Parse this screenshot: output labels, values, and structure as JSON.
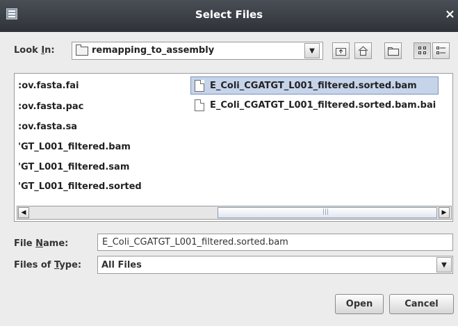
{
  "window": {
    "title": "Select Files",
    "close_glyph": "×"
  },
  "look_in": {
    "label_prefix": "Look ",
    "label_mnemonic": "I",
    "label_suffix": "n:",
    "value": "remapping_to_assembly",
    "dropdown_arrow": "▼"
  },
  "toolbar": {
    "icons": [
      "up-one-level-icon",
      "home-icon",
      "new-folder-icon",
      "list-view-icon",
      "details-view-icon"
    ]
  },
  "file_list": {
    "column1": [
      {
        "name": "cov.fasta.fai",
        "display": ":ov.fasta.fai"
      },
      {
        "name": "cov.fasta.pac",
        "display": ":ov.fasta.pac"
      },
      {
        "name": "cov.fasta.sa",
        "display": ":ov.fasta.sa"
      },
      {
        "name": "GT_L001_filtered.bam",
        "display": "'GT_L001_filtered.bam"
      },
      {
        "name": "GT_L001_filtered.sam",
        "display": "'GT_L001_filtered.sam"
      },
      {
        "name": "GT_L001_filtered.sorted",
        "display": "'GT_L001_filtered.sorted"
      }
    ],
    "column2": [
      {
        "name": "E_Coli_CGATGT_L001_filtered.sorted.bam",
        "selected": true
      },
      {
        "name": "E_Coli_CGATGT_L001_filtered.sorted.bam.bai",
        "selected": false
      }
    ],
    "scroll_left": "◀",
    "scroll_right": "▶",
    "scroll_grip": "|||"
  },
  "file_name": {
    "label_prefix": "File ",
    "label_mnemonic": "N",
    "label_suffix": "ame:",
    "value": "E_Coli_CGATGT_L001_filtered.sorted.bam"
  },
  "files_of_type": {
    "label_prefix": "Files of ",
    "label_mnemonic": "T",
    "label_suffix": "ype:",
    "value": "All Files",
    "dropdown_arrow": "▼"
  },
  "buttons": {
    "open": "Open",
    "cancel": "Cancel"
  },
  "colors": {
    "titlebar": "#383c43",
    "selection": "#c6d4ea",
    "dialog_bg": "#ececec"
  }
}
